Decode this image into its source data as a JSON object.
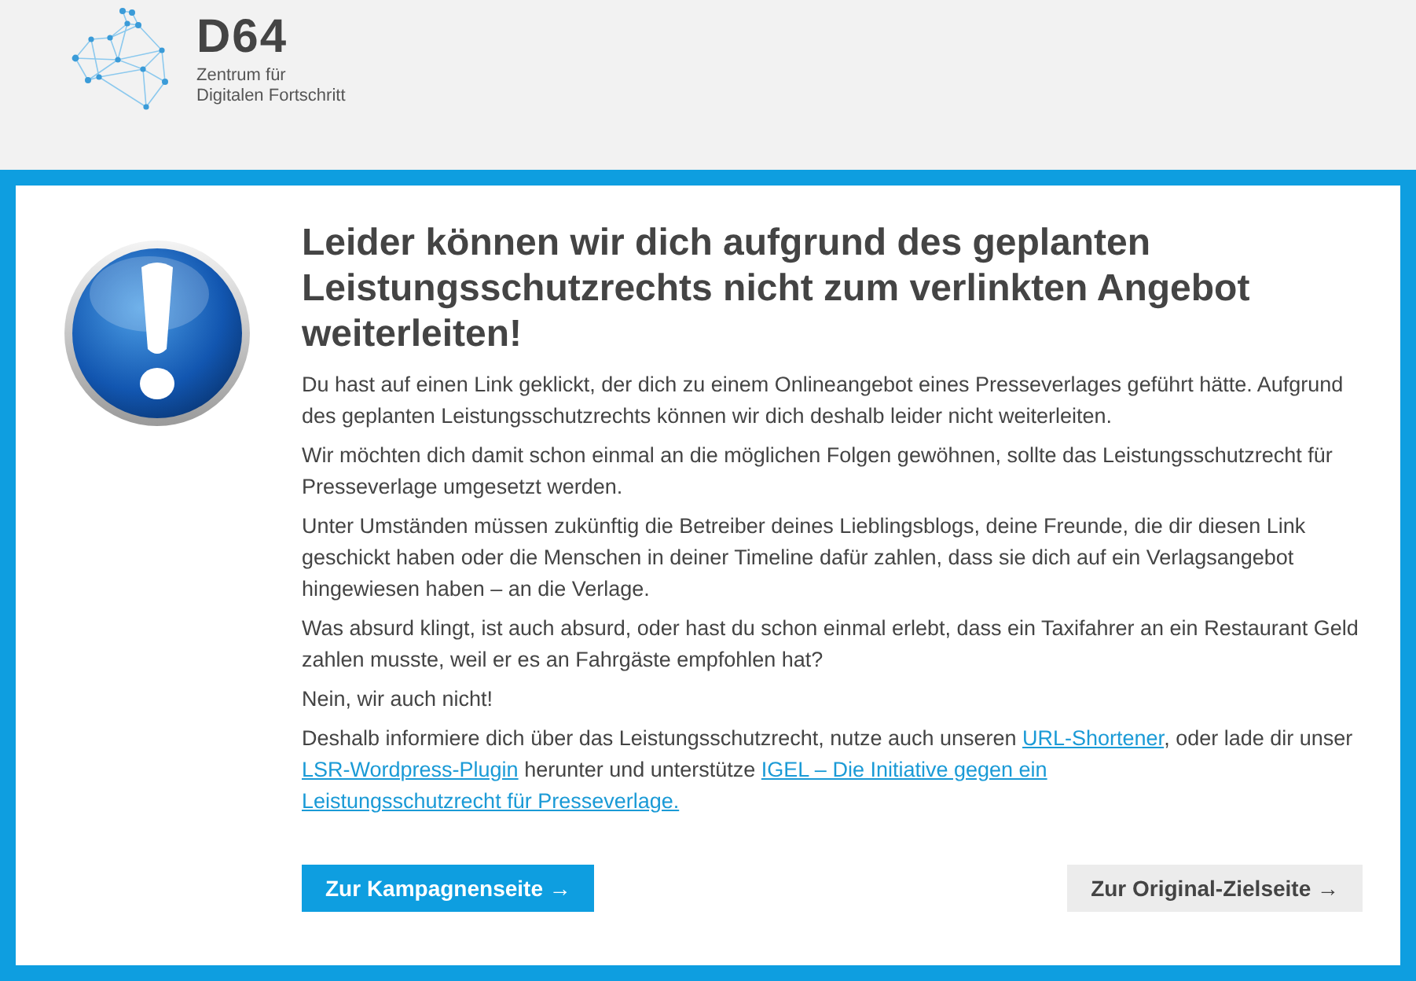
{
  "header": {
    "logo_title": "D64",
    "logo_subtitle_lines": [
      "Zentrum für",
      "Digitalen Fortschritt"
    ]
  },
  "notice": {
    "heading": "Leider können wir dich aufgrund des geplanten Leistungsschutzrechts nicht zum verlinkten Angebot weiterleiten!",
    "paragraphs": [
      [
        {
          "kind": "text",
          "text": "Du hast auf einen Link geklickt, der dich zu einem Onlineangebot eines Presseverlages geführt hätte. Aufgrund des geplanten Leistungsschutzrechts können wir dich deshalb leider nicht weiterleiten."
        }
      ],
      [
        {
          "kind": "text",
          "text": "Wir möchten dich damit schon einmal an die möglichen Folgen gewöhnen, sollte das Leistungsschutzrecht für Presseverlage umgesetzt werden."
        }
      ],
      [
        {
          "kind": "text",
          "text": "Unter Umständen müssen zukünftig die Betreiber deines Lieblingsblogs, deine Freunde, die dir diesen Link geschickt haben oder die Menschen in deiner Timeline dafür zahlen, dass sie dich auf ein Verlagsangebot hingewiesen haben – an die Verlage."
        }
      ],
      [
        {
          "kind": "text",
          "text": "Was absurd klingt, ist auch absurd, oder hast du schon einmal erlebt, dass ein Taxifahrer an ein Restaurant Geld zahlen musste, weil er es an Fahrgäste empfohlen hat?"
        }
      ],
      [
        {
          "kind": "text",
          "text": "Nein, wir auch nicht!"
        }
      ],
      [
        {
          "kind": "text",
          "text": "Deshalb informiere dich über das Leistungsschutzrecht, nutze auch unseren "
        },
        {
          "kind": "link",
          "text": "URL-Shortener"
        },
        {
          "kind": "text",
          "text": ", oder lade dir unser "
        },
        {
          "kind": "link",
          "text": "LSR-Wordpress-Plugin"
        },
        {
          "kind": "text",
          "text": " herunter und unterstütze "
        },
        {
          "kind": "link",
          "text": "IGEL – Die Initiative gegen ein"
        },
        {
          "kind": "link",
          "text": "Leistungsschutzrecht für Presseverlage."
        }
      ]
    ],
    "buttons": [
      {
        "label": "Zur Kampagnenseite →",
        "kind": "primary"
      },
      {
        "label": "Zur Original-Zielseite →",
        "kind": "secondary"
      }
    ]
  }
}
